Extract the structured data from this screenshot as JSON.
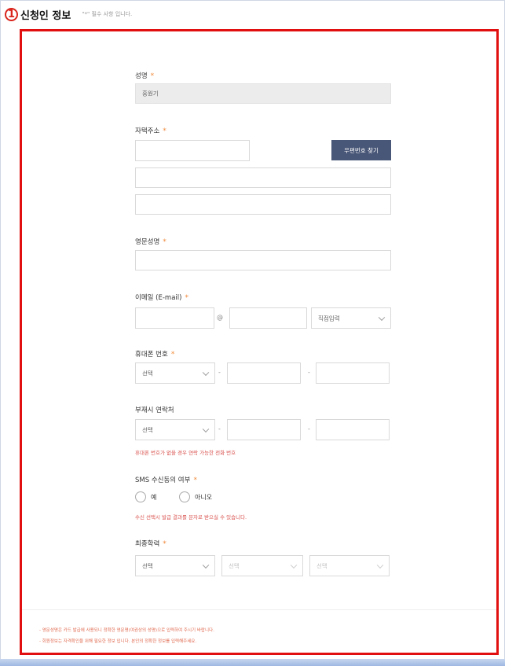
{
  "section": {
    "step": "1",
    "title": "신청인 정보",
    "required_note": "\"*\" 필수 사항 입니다."
  },
  "form": {
    "name": {
      "label": "성명",
      "required_mark": "*",
      "value": "홍원기"
    },
    "address": {
      "label": "자택주소",
      "required_mark": "*",
      "zip_value": "",
      "zip_button": "우편번호 찾기",
      "line1": "",
      "line2": ""
    },
    "english_name": {
      "label": "영문성명",
      "required_mark": "*",
      "value": ""
    },
    "email": {
      "label": "이메일 (E-mail)",
      "required_mark": "*",
      "local": "",
      "at": "@",
      "domain": "",
      "domain_select": "직접입력"
    },
    "mobile": {
      "label": "휴대폰 번호",
      "required_mark": "*",
      "prefix_select": "선택",
      "sep": "-",
      "mid": "",
      "last": ""
    },
    "alt_contact": {
      "label": "부재시 연락처",
      "prefix_select": "선택",
      "sep": "-",
      "mid": "",
      "last": "",
      "helper": "휴대폰 번호가 없을 경우 연락 가능한 전화 번호"
    },
    "sms": {
      "label": "SMS 수신동의 여부",
      "required_mark": "*",
      "yes": "예",
      "no": "아니오",
      "helper": "수신 선택시 발급 결과를 문자로 받으실 수 있습니다."
    },
    "education": {
      "label": "최종학력",
      "required_mark": "*",
      "select1": "선택",
      "select2": "선택",
      "select3": "선택"
    }
  },
  "footnotes": [
    "영문성명은 카드 발급에 사용되니 정확한 영문명(여권상의 성명)으로 입력하여 주시기 바랍니다.",
    "회원정보는 자격확인을 위해 필요한 정보 입니다. 본인의 정확한 정보를 입력해주세요."
  ]
}
